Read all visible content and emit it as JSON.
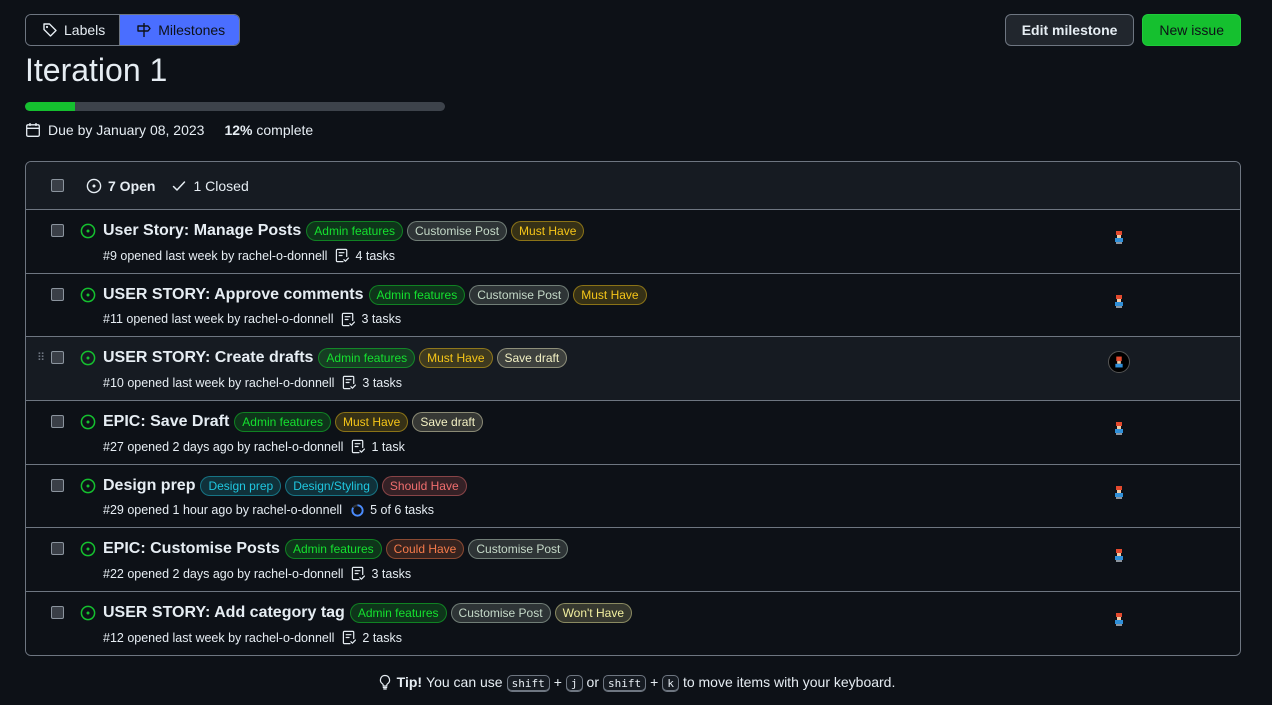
{
  "nav": {
    "labels_label": "Labels",
    "milestones_label": "Milestones"
  },
  "actions": {
    "edit_label": "Edit milestone",
    "new_label": "New issue"
  },
  "milestone": {
    "title": "Iteration 1",
    "due": "Due by January 08, 2023",
    "percent": "12%",
    "complete_word": "complete",
    "progress_fraction": 0.12
  },
  "counts": {
    "open": "7 Open",
    "closed": "1 Closed"
  },
  "colors": {
    "accent_blue": "#4a6eff",
    "open_green": "#15c02f",
    "bg": "#0d1117"
  },
  "issues": [
    {
      "title": "User Story: Manage Posts",
      "labels": [
        {
          "text": "Admin features",
          "color": "#15e02f"
        },
        {
          "text": "Customise Post",
          "color": "#c5d9c8"
        },
        {
          "text": "Must Have",
          "color": "#f5c518"
        }
      ],
      "meta": "#9 opened last week by rachel-o-donnell",
      "tasks": "4 tasks",
      "progress_icon": "tasklist-icon"
    },
    {
      "title": "USER STORY: Approve comments",
      "labels": [
        {
          "text": "Admin features",
          "color": "#15e02f"
        },
        {
          "text": "Customise Post",
          "color": "#c5d9c8"
        },
        {
          "text": "Must Have",
          "color": "#f5c518"
        }
      ],
      "meta": "#11 opened last week by rachel-o-donnell",
      "tasks": "3 tasks",
      "progress_icon": "tasklist-icon"
    },
    {
      "title": "USER STORY: Create drafts",
      "labels": [
        {
          "text": "Admin features",
          "color": "#15e02f"
        },
        {
          "text": "Must Have",
          "color": "#f5c518"
        },
        {
          "text": "Save draft",
          "color": "#f2f0c4"
        }
      ],
      "meta": "#10 opened last week by rachel-o-donnell",
      "tasks": "3 tasks",
      "progress_icon": "tasklist-icon"
    },
    {
      "title": "EPIC: Save Draft",
      "labels": [
        {
          "text": "Admin features",
          "color": "#15e02f"
        },
        {
          "text": "Must Have",
          "color": "#f5c518"
        },
        {
          "text": "Save draft",
          "color": "#f2f0c4"
        }
      ],
      "meta": "#27 opened 2 days ago by rachel-o-donnell",
      "tasks": "1 task",
      "progress_icon": "tasklist-icon"
    },
    {
      "title": "Design prep",
      "labels": [
        {
          "text": "Design prep",
          "color": "#1fc7e0"
        },
        {
          "text": "Design/Styling",
          "color": "#1fc7e0"
        },
        {
          "text": "Should Have",
          "color": "#f06e6e"
        }
      ],
      "meta": "#29 opened 1 hour ago by rachel-o-donnell",
      "tasks": "5 of 6 tasks",
      "progress_icon": "progress-ring-icon"
    },
    {
      "title": "EPIC: Customise Posts",
      "labels": [
        {
          "text": "Admin features",
          "color": "#15e02f"
        },
        {
          "text": "Could Have",
          "color": "#f57a4a"
        },
        {
          "text": "Customise Post",
          "color": "#c5d9c8"
        }
      ],
      "meta": "#22 opened 2 days ago by rachel-o-donnell",
      "tasks": "3 tasks",
      "progress_icon": "tasklist-icon"
    },
    {
      "title": "USER STORY: Add category tag",
      "labels": [
        {
          "text": "Admin features",
          "color": "#15e02f"
        },
        {
          "text": "Customise Post",
          "color": "#c5d9c8"
        },
        {
          "text": "Won't Have",
          "color": "#f2f0a0"
        }
      ],
      "meta": "#12 opened last week by rachel-o-donnell",
      "tasks": "2 tasks",
      "progress_icon": "tasklist-icon"
    }
  ],
  "tip": {
    "bold": "Tip!",
    "pre": "You can use",
    "key1": "shift",
    "plus1": "+",
    "key2": "j",
    "or": "or",
    "key3": "shift",
    "plus2": "+",
    "key4": "k",
    "post": "to move items with your keyboard."
  }
}
